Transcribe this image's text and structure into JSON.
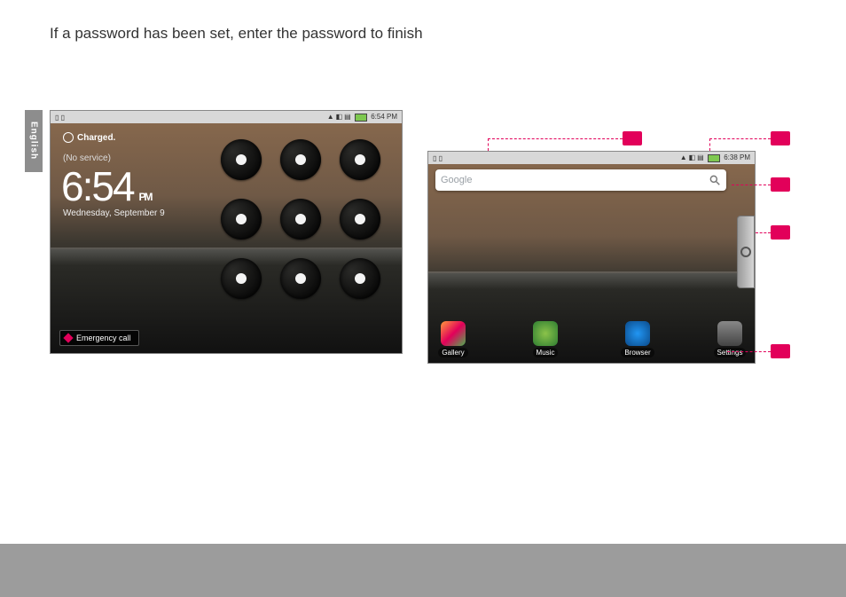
{
  "instruction": "If a password has been set, enter the password to finish",
  "side_tab": "English",
  "lock": {
    "status_left": "▯ ▯",
    "status_time": "6:54 PM",
    "charged": "Charged.",
    "no_service": "(No service)",
    "clock": "6:54",
    "ampm": "PM",
    "date": "Wednesday, September 9",
    "emergency": "Emergency call"
  },
  "home": {
    "status_time": "6:38 PM",
    "search_placeholder": "Google",
    "apps": {
      "gallery": "Gallery",
      "music": "Music",
      "browser": "Browser",
      "settings": "Settings"
    }
  }
}
